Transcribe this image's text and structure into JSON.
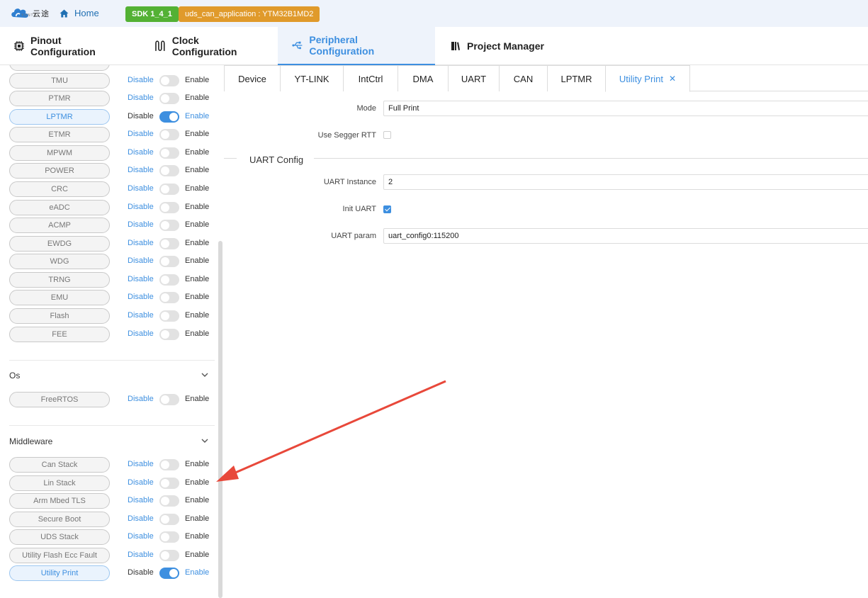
{
  "topbar": {
    "logo_text": "云途",
    "logo_sub": "YUNTU",
    "home_label": "Home",
    "sdk_badge": "SDK 1_4_1",
    "project_badge": "uds_can_application : YTM32B1MD2"
  },
  "main_tabs": [
    {
      "label": "Pinout Configuration",
      "icon": "chip-icon"
    },
    {
      "label": "Clock Configuration",
      "icon": "clock-wave-icon"
    },
    {
      "label": "Peripheral Configuration",
      "icon": "usb-icon",
      "active": true
    },
    {
      "label": "Project Manager",
      "icon": "book-icon"
    }
  ],
  "left_panel": {
    "disable_label": "Disable",
    "enable_label": "Enable",
    "peripherals": [
      {
        "name": "TMU",
        "enabled": false
      },
      {
        "name": "PTMR",
        "enabled": false
      },
      {
        "name": "LPTMR",
        "enabled": true
      },
      {
        "name": "ETMR",
        "enabled": false
      },
      {
        "name": "MPWM",
        "enabled": false
      },
      {
        "name": "POWER",
        "enabled": false
      },
      {
        "name": "CRC",
        "enabled": false
      },
      {
        "name": "eADC",
        "enabled": false
      },
      {
        "name": "ACMP",
        "enabled": false
      },
      {
        "name": "EWDG",
        "enabled": false
      },
      {
        "name": "WDG",
        "enabled": false
      },
      {
        "name": "TRNG",
        "enabled": false
      },
      {
        "name": "EMU",
        "enabled": false
      },
      {
        "name": "Flash",
        "enabled": false
      },
      {
        "name": "FEE",
        "enabled": false
      }
    ],
    "os_section": {
      "title": "Os",
      "items": [
        {
          "name": "FreeRTOS",
          "enabled": false
        }
      ]
    },
    "middleware_section": {
      "title": "Middleware",
      "items": [
        {
          "name": "Can Stack",
          "enabled": false
        },
        {
          "name": "Lin Stack",
          "enabled": false
        },
        {
          "name": "Arm Mbed TLS",
          "enabled": false
        },
        {
          "name": "Secure Boot",
          "enabled": false
        },
        {
          "name": "UDS Stack",
          "enabled": false
        },
        {
          "name": "Utility Flash Ecc Fault",
          "enabled": false
        },
        {
          "name": "Utility Print",
          "enabled": true
        }
      ]
    }
  },
  "sub_tabs": [
    {
      "label": "Device"
    },
    {
      "label": "YT-LINK"
    },
    {
      "label": "IntCtrl"
    },
    {
      "label": "DMA"
    },
    {
      "label": "UART"
    },
    {
      "label": "CAN"
    },
    {
      "label": "LPTMR"
    },
    {
      "label": "Utility Print",
      "active": true,
      "closable": true
    }
  ],
  "form": {
    "mode_label": "Mode",
    "mode_value": "Full Print",
    "segger_label": "Use Segger RTT",
    "segger_checked": false,
    "uart_config_title": "UART Config",
    "uart_instance_label": "UART Instance",
    "uart_instance_value": "2",
    "init_uart_label": "Init UART",
    "init_uart_checked": true,
    "uart_param_label": "UART param",
    "uart_param_value": "uart_config0:115200"
  },
  "colors": {
    "accent": "#3d8fe0",
    "sdk_badge": "#53b134",
    "project_badge": "#e09a2b",
    "arrow": "#e8483a"
  }
}
